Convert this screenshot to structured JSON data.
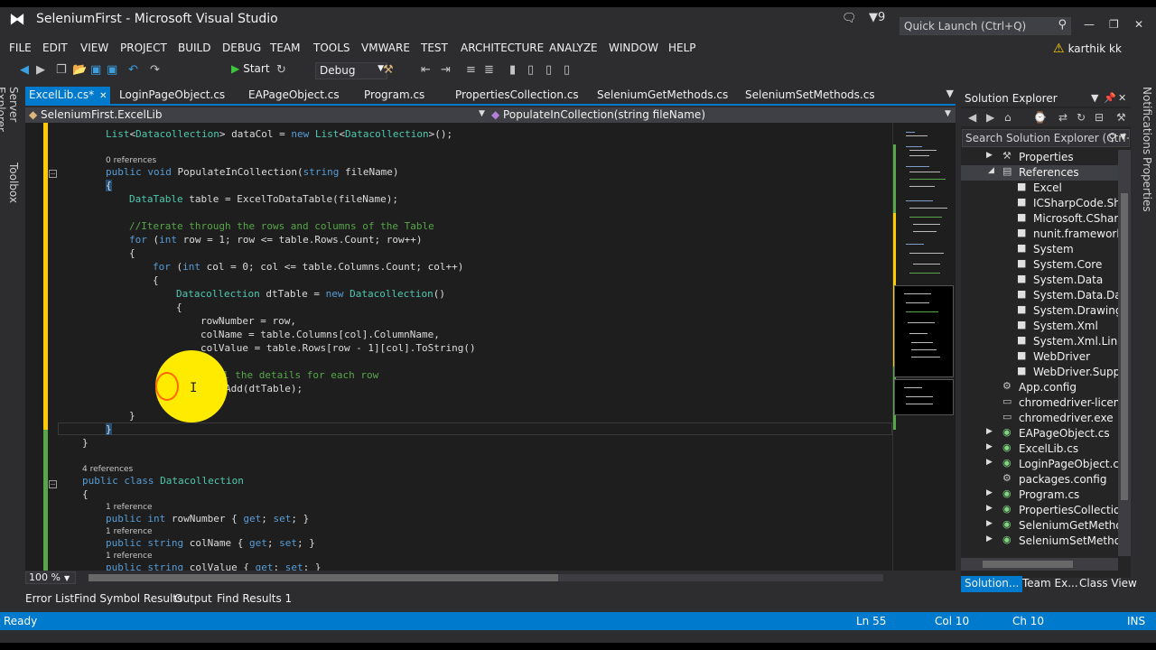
{
  "window": {
    "title": "SeleniumFirst - Microsoft Visual Studio",
    "feedback_count": "9",
    "quick_launch_placeholder": "Quick Launch (Ctrl+Q)",
    "user_name": "karthik kk"
  },
  "menu": [
    "FILE",
    "EDIT",
    "VIEW",
    "PROJECT",
    "BUILD",
    "DEBUG",
    "TEAM",
    "TOOLS",
    "VMWARE",
    "TEST",
    "ARCHITECTURE",
    "ANALYZE",
    "WINDOW",
    "HELP"
  ],
  "toolbar": {
    "start_label": "Start",
    "configuration": "Debug"
  },
  "side_tabs": {
    "left": [
      "Server Explorer",
      "Toolbox"
    ],
    "right": [
      "Notifications",
      "Properties"
    ]
  },
  "doc_tabs": [
    {
      "label": "ExcelLib.cs*",
      "active": true
    },
    {
      "label": "LoginPageObject.cs",
      "active": false
    },
    {
      "label": "EAPageObject.cs",
      "active": false
    },
    {
      "label": "Program.cs",
      "active": false
    },
    {
      "label": "PropertiesCollection.cs",
      "active": false
    },
    {
      "label": "SeleniumGetMethods.cs",
      "active": false
    },
    {
      "label": "SeleniumSetMethods.cs",
      "active": false
    }
  ],
  "nav_bar": {
    "type_scope": "SeleniumFirst.ExcelLib",
    "member_scope": "PopulateInCollection(string fileName)"
  },
  "code": {
    "l1": {
      "ty1": "List",
      "p1": "<",
      "ty2": "Datacollection",
      "p2": "> dataCol = ",
      "kw": "new",
      "p3": " ",
      "ty3": "List",
      "p4": "<",
      "ty4": "Datacollection",
      "p5": ">();"
    },
    "lens1": "0 references",
    "l2": {
      "kw1": "public",
      "kw2": "void",
      "p1": " PopulateInCollection(",
      "kw3": "string",
      "p2": " fileName)"
    },
    "l3": "{",
    "l4": {
      "ty": "DataTable",
      "p": " table = ExcelToDataTable(fileName);"
    },
    "l5": "//Iterate through the rows and columns of the Table",
    "l6": {
      "kw1": "for",
      "p1": " (",
      "kw2": "int",
      "p2": " row = 1; row <= table.Rows.Count; row++)"
    },
    "l7": "{",
    "l8": {
      "kw1": "for",
      "p1": " (",
      "kw2": "int",
      "p2": " col = 0; col <= table.Columns.Count; col++)"
    },
    "l9": "{",
    "l10": {
      "ty1": "Datacollection",
      "p1": " dtTable = ",
      "kw": "new",
      "p2": " ",
      "ty2": "Datacollection",
      "p3": "()"
    },
    "l11": "{",
    "l12": "rowNumber = row,",
    "l13": "colName = table.Columns[col].ColumnName,",
    "l14": "colValue = table.Rows[row - 1][col].ToString()",
    "l15": "l the details for each row",
    "l16": "Add(dtTable);",
    "l17": "}",
    "l18": "}",
    "l19": "}",
    "l20": "}",
    "lens2": "4 references",
    "l21": {
      "kw1": "public",
      "kw2": "class",
      "p": " ",
      "ty": "Datacollection"
    },
    "l22": "{",
    "lens3": "1 reference",
    "l23": {
      "kw1": "public",
      "kw2": "int",
      "p1": " rowNumber { ",
      "kw3": "get",
      "p2": "; ",
      "kw4": "set",
      "p3": "; }"
    },
    "lens4": "1 reference",
    "l24": {
      "kw1": "public",
      "kw2": "string",
      "p1": " colName { ",
      "kw3": "get",
      "p2": "; ",
      "kw4": "set",
      "p3": "; }"
    },
    "lens5": "1 reference",
    "l25": {
      "kw1": "public",
      "kw2": "string",
      "p1": " colValue { ",
      "kw3": "get",
      "p2": "; ",
      "kw4": "set",
      "p3": "; }"
    }
  },
  "editor": {
    "zoom": "100 %"
  },
  "tool_tabs": [
    "Error List",
    "Find Symbol Results",
    "Output",
    "Find Results 1"
  ],
  "status": {
    "text": "Ready",
    "ln": "Ln 55",
    "col": "Col 10",
    "ch": "Ch 10",
    "mode": "INS"
  },
  "solution_explorer": {
    "title": "Solution Explorer",
    "search_placeholder": "Search Solution Explorer (Ctrl+;)",
    "items": [
      {
        "label": "Properties",
        "icon": "wrench-icon"
      },
      {
        "label": "References",
        "icon": "references-icon"
      },
      {
        "label": "Excel",
        "icon": "assembly-icon"
      },
      {
        "label": "ICSharpCode.SharpZipLib",
        "icon": "assembly-icon"
      },
      {
        "label": "Microsoft.CSharp",
        "icon": "assembly-icon"
      },
      {
        "label": "nunit.framework",
        "icon": "assembly-icon"
      },
      {
        "label": "System",
        "icon": "assembly-icon"
      },
      {
        "label": "System.Core",
        "icon": "assembly-icon"
      },
      {
        "label": "System.Data",
        "icon": "assembly-icon"
      },
      {
        "label": "System.Data.DataSetExtensions",
        "icon": "assembly-icon"
      },
      {
        "label": "System.Drawing",
        "icon": "assembly-icon"
      },
      {
        "label": "System.Xml",
        "icon": "assembly-icon"
      },
      {
        "label": "System.Xml.Linq",
        "icon": "assembly-icon"
      },
      {
        "label": "WebDriver",
        "icon": "assembly-icon"
      },
      {
        "label": "WebDriver.Support",
        "icon": "assembly-icon"
      },
      {
        "label": "App.config",
        "icon": "config-file-icon"
      },
      {
        "label": "chromedriver-license.txt",
        "icon": "file-icon"
      },
      {
        "label": "chromedriver.exe",
        "icon": "file-icon"
      },
      {
        "label": "EAPageObject.cs",
        "icon": "csharp-file-icon"
      },
      {
        "label": "ExcelLib.cs",
        "icon": "csharp-file-icon"
      },
      {
        "label": "LoginPageObject.cs",
        "icon": "csharp-file-icon"
      },
      {
        "label": "packages.config",
        "icon": "config-file-icon"
      },
      {
        "label": "Program.cs",
        "icon": "csharp-file-icon"
      },
      {
        "label": "PropertiesCollection.cs",
        "icon": "csharp-file-icon"
      },
      {
        "label": "SeleniumGetMethods.cs",
        "icon": "csharp-file-icon"
      },
      {
        "label": "SeleniumSetMethods.cs",
        "icon": "csharp-file-icon"
      }
    ],
    "tabs": [
      "Solution...",
      "Team Ex...",
      "Class View"
    ]
  },
  "colors": {
    "accent": "#007acc",
    "background": "#2d2d30",
    "editor_bg": "#1e1e1e",
    "keyword": "#569cd6",
    "type": "#4ec9b0",
    "comment": "#57a64a"
  }
}
